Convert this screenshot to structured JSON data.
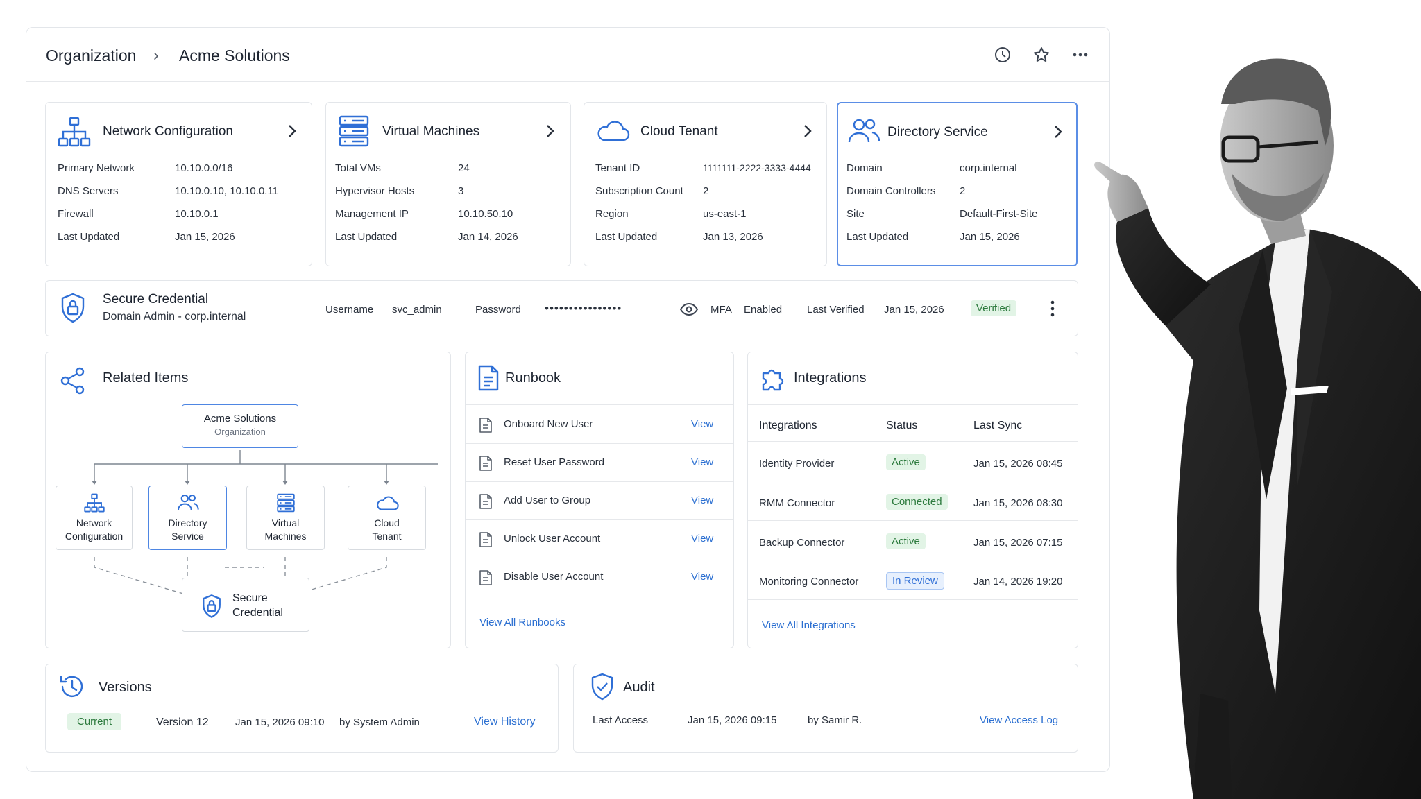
{
  "breadcrumb": {
    "root": "Organization",
    "separator": "›",
    "current": "Acme Solutions"
  },
  "header_icons": [
    "history-icon",
    "star-icon",
    "more-icon"
  ],
  "cards": [
    {
      "title": "Network Configuration",
      "icon": "network-icon",
      "rows": [
        [
          "Primary Network",
          "10.10.0.0/16"
        ],
        [
          "DNS Servers",
          "10.10.0.10, 10.10.0.11"
        ],
        [
          "Firewall",
          "10.10.0.1"
        ],
        [
          "Last Updated",
          "Jan 15, 2026"
        ]
      ]
    },
    {
      "title": "Virtual Machines",
      "icon": "server-icon",
      "rows": [
        [
          "Total VMs",
          "24"
        ],
        [
          "Hypervisor Hosts",
          "3"
        ],
        [
          "Management IP",
          "10.10.50.10"
        ],
        [
          "Last Updated",
          "Jan 14, 2026"
        ]
      ]
    },
    {
      "title": "Cloud Tenant",
      "icon": "cloud-icon",
      "rows": [
        [
          "Tenant ID",
          "1111111-2222-3333-4444"
        ],
        [
          "Subscription Count",
          "2"
        ],
        [
          "Region",
          "us-east-1"
        ],
        [
          "Last Updated",
          "Jan 13, 2026"
        ]
      ]
    },
    {
      "title": "Directory Service",
      "icon": "users-icon",
      "rows": [
        [
          "Domain",
          "corp.internal"
        ],
        [
          "Domain Controllers",
          "2"
        ],
        [
          "Site",
          "Default-First-Site"
        ],
        [
          "Last Updated",
          "Jan 15, 2026"
        ]
      ]
    }
  ],
  "credential": {
    "title": "Secure Credential",
    "subtitle": "Domain Admin - corp.internal",
    "username_label": "Username",
    "username": "svc_admin",
    "password_label": "Password",
    "password": "••••••••••••••••",
    "mfa_label": "MFA",
    "mfa_value": "Enabled",
    "verified_label": "Last Verified",
    "verified_date": "Jan 15, 2026",
    "status": "Verified"
  },
  "related": {
    "title": "Related Items",
    "root": {
      "name": "Acme Solutions",
      "type": "Organization"
    },
    "children": [
      {
        "line1": "Network",
        "line2": "Configuration"
      },
      {
        "line1": "Directory",
        "line2": "Service"
      },
      {
        "line1": "Virtual",
        "line2": "Machines"
      },
      {
        "line1": "Cloud",
        "line2": "Tenant"
      }
    ],
    "secure": {
      "line1": "Secure",
      "line2": "Credential"
    }
  },
  "runbook": {
    "title": "Runbook",
    "items": [
      {
        "name": "Onboard New User",
        "action": "View"
      },
      {
        "name": "Reset User Password",
        "action": "View"
      },
      {
        "name": "Add User to Group",
        "action": "View"
      },
      {
        "name": "Unlock User Account",
        "action": "View"
      },
      {
        "name": "Disable User Account",
        "action": "View"
      }
    ],
    "view_all": "View All Runbooks"
  },
  "integrations": {
    "title": "Integrations",
    "columns": [
      "Integrations",
      "Status",
      "Last Sync"
    ],
    "rows": [
      {
        "name": "Identity Provider",
        "status": "Active",
        "sync": "Jan 15, 2026 08:45"
      },
      {
        "name": "RMM Connector",
        "status": "Connected",
        "sync": "Jan 15, 2026 08:30"
      },
      {
        "name": "Backup Connector",
        "status": "Active",
        "sync": "Jan 15, 2026 07:15"
      },
      {
        "name": "Monitoring Connector",
        "status": "In Review",
        "sync": "Jan 14, 2026 19:20"
      }
    ],
    "view_all": "View All Integrations"
  },
  "versions": {
    "title": "Versions",
    "badge": "Current",
    "version": "Version 12",
    "date": "Jan 15, 2026 09:10",
    "by": "by System Admin",
    "link": "View History"
  },
  "audit": {
    "title": "Audit",
    "label": "Last Access",
    "date": "Jan 15, 2026 09:15",
    "by": "by Samir R.",
    "link": "View Access Log"
  }
}
